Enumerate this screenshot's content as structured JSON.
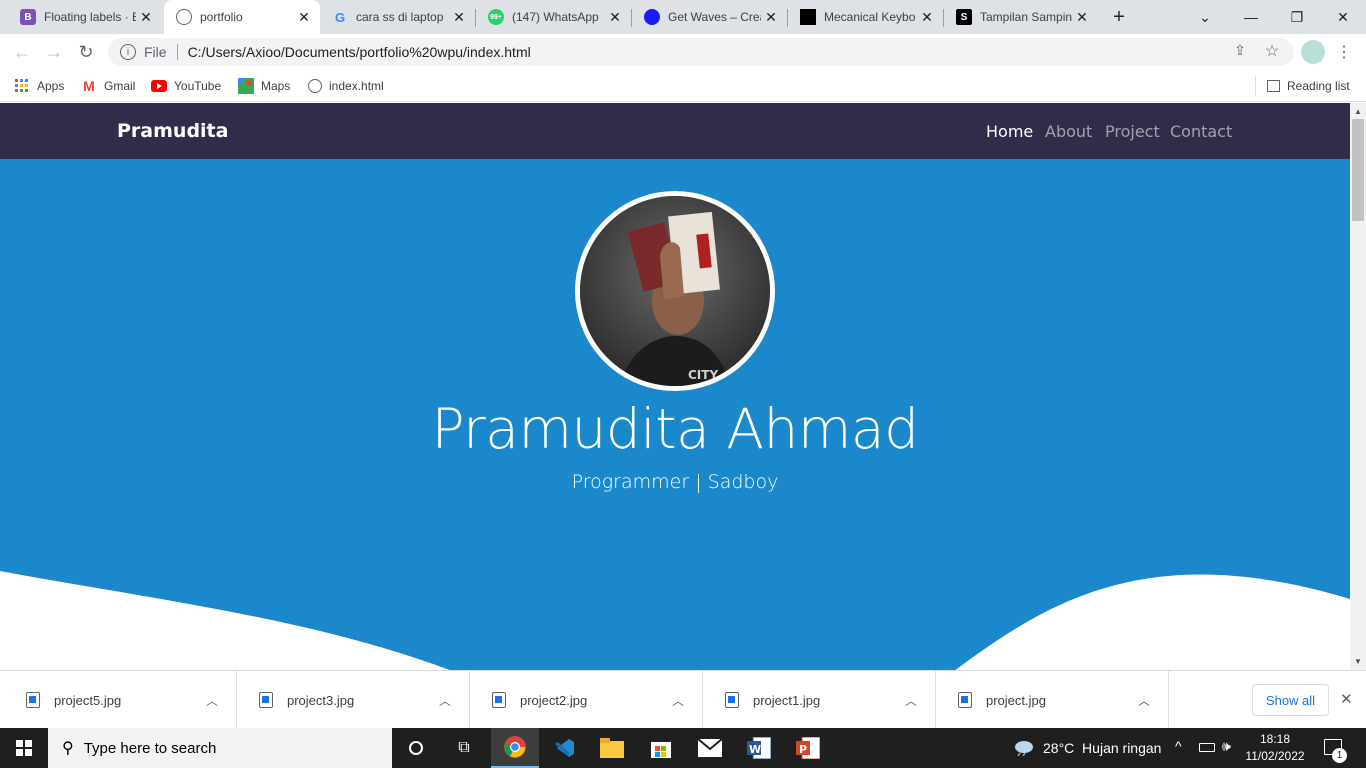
{
  "browser": {
    "tabs": [
      {
        "title": "Floating labels · B",
        "favicon": "bootstrap-icon",
        "color": "#7952b3",
        "active": false
      },
      {
        "title": "portfolio",
        "favicon": "globe-icon",
        "color": "#5f6368",
        "active": true
      },
      {
        "title": "cara ss di laptop",
        "favicon": "google-icon",
        "color": "#4285f4",
        "active": false
      },
      {
        "title": "(147) WhatsApp",
        "favicon": "whatsapp-icon",
        "color": "#25d366",
        "active": false
      },
      {
        "title": "Get Waves – Crea",
        "favicon": "waves-icon",
        "color": "#1a1aff",
        "active": false
      },
      {
        "title": "Mecanical Keybo",
        "favicon": "keyboard-icon",
        "color": "#000000",
        "active": false
      },
      {
        "title": "Tampilan Sampin",
        "favicon": "s-icon",
        "color": "#000000",
        "active": false
      }
    ],
    "address": {
      "scheme_label": "File",
      "url": "C:/Users/Axioo/Documents/portfolio%20wpu/index.html"
    },
    "bookmarks": [
      {
        "label": "Apps",
        "icon": "apps-grid-icon"
      },
      {
        "label": "Gmail",
        "icon": "gmail-icon"
      },
      {
        "label": "YouTube",
        "icon": "youtube-icon"
      },
      {
        "label": "Maps",
        "icon": "maps-icon"
      },
      {
        "label": "index.html",
        "icon": "globe-icon"
      }
    ],
    "reading_list": "Reading list"
  },
  "page": {
    "brand": "Pramudita",
    "nav": [
      "Home",
      "About",
      "Project",
      "Contact"
    ],
    "hero_name": "Pramudita Ahmad",
    "hero_subtitle": "Programmer | Sadboy",
    "hero_color": "#1a88ca",
    "navbar_color": "#332b4a"
  },
  "downloads": {
    "items": [
      "project5.jpg",
      "project3.jpg",
      "project2.jpg",
      "project1.jpg",
      "project.jpg"
    ],
    "show_all": "Show all"
  },
  "taskbar": {
    "search_placeholder": "Type here to search",
    "weather": "28°C  Hujan ringan",
    "time": "18:18",
    "date": "11/02/2022",
    "notification_count": "1"
  }
}
